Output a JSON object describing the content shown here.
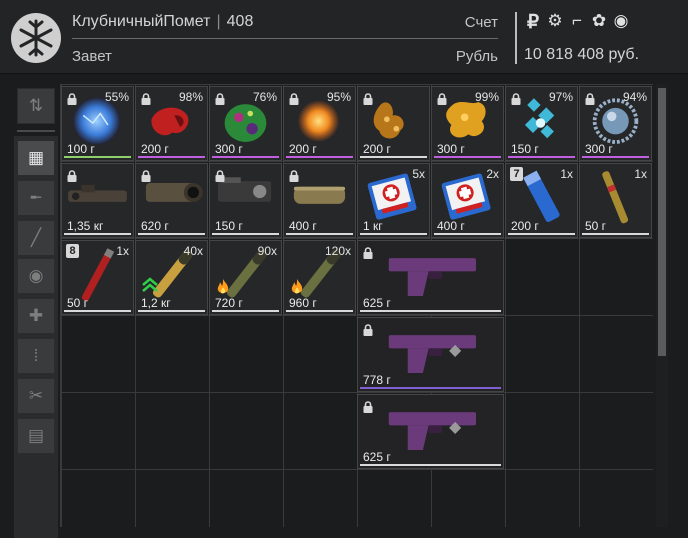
{
  "header": {
    "player_name": "КлубничныйПомет",
    "separator": "|",
    "player_level": "408",
    "faction": "Завет",
    "account_label": "Счет",
    "currency_label": "Рубль",
    "balance": "10 818 408 руб.",
    "currency_icons": [
      "ruble-icon",
      "gear-icon",
      "boot-icon",
      "flower-icon",
      "coin-icon"
    ]
  },
  "sidebar": {
    "items": [
      {
        "name": "sort-icon",
        "symbol": "⇅",
        "active": false
      },
      {
        "name": "grid-icon",
        "symbol": "▦",
        "active": true
      },
      {
        "name": "rifle-icon",
        "symbol": "╾",
        "active": false
      },
      {
        "name": "knife-icon",
        "symbol": "╱",
        "active": false
      },
      {
        "name": "artifact-icon",
        "symbol": "◉",
        "active": false
      },
      {
        "name": "medkit-icon",
        "symbol": "✚",
        "active": false
      },
      {
        "name": "ammo-icon",
        "symbol": "⁞",
        "active": false
      },
      {
        "name": "tools-icon",
        "symbol": "✂",
        "active": false
      },
      {
        "name": "archive-icon",
        "symbol": "▤",
        "active": false
      }
    ]
  },
  "items": [
    {
      "id": "art1",
      "weight": "100 г",
      "badge_tr": "55%",
      "lock": true,
      "underline": "#8fd06a",
      "color": "#3a7ad8"
    },
    {
      "id": "art2",
      "weight": "200 г",
      "badge_tr": "98%",
      "lock": true,
      "underline": "#c060e0",
      "color": "#c02020"
    },
    {
      "id": "art3",
      "weight": "300 г",
      "badge_tr": "76%",
      "lock": true,
      "underline": "#c060e0",
      "color": "#2a8a3a"
    },
    {
      "id": "art4",
      "weight": "200 г",
      "badge_tr": "95%",
      "lock": true,
      "underline": "#c060e0",
      "color": "#f08a20"
    },
    {
      "id": "art5",
      "weight": "200 г",
      "badge_tr": "",
      "lock": true,
      "underline": "#d9d9d9",
      "color": "#b8761a"
    },
    {
      "id": "art6",
      "weight": "300 г",
      "badge_tr": "99%",
      "lock": true,
      "underline": "#c060e0",
      "color": "#e0a020"
    },
    {
      "id": "art7",
      "weight": "150 г",
      "badge_tr": "97%",
      "lock": true,
      "underline": "#c060e0",
      "color": "#40b8d8"
    },
    {
      "id": "art8",
      "weight": "300 г",
      "badge_tr": "94%",
      "lock": true,
      "underline": "#c060e0",
      "color": "#7898b8"
    },
    {
      "id": "scope1",
      "weight": "1,35 кг",
      "badge_tr": "",
      "lock": true,
      "underline": "#d9d9d9",
      "color": "#4a4238"
    },
    {
      "id": "scope2",
      "weight": "620 г",
      "badge_tr": "",
      "lock": true,
      "underline": "#d9d9d9",
      "color": "#5a5040"
    },
    {
      "id": "scope3",
      "weight": "150 г",
      "badge_tr": "",
      "lock": true,
      "underline": "#d9d9d9",
      "color": "#3a3a3a"
    },
    {
      "id": "silencer",
      "weight": "400 г",
      "badge_tr": "",
      "lock": true,
      "underline": "#d9d9d9",
      "color": "#8a7a50"
    },
    {
      "id": "medkit1",
      "weight": "1 кг",
      "badge_tr": "5x",
      "lock": false,
      "underline": "#d9d9d9",
      "color": "#2a6ad0"
    },
    {
      "id": "medkit2",
      "weight": "400 г",
      "badge_tr": "2x",
      "lock": false,
      "underline": "#d9d9d9",
      "color": "#2a6ad0"
    },
    {
      "id": "inhaler",
      "weight": "200 г",
      "badge_tr": "1x",
      "lock": false,
      "num_badge": "7",
      "underline": "#d9d9d9",
      "color": "#2a6ad0"
    },
    {
      "id": "grenade",
      "weight": "50 г",
      "badge_tr": "1x",
      "lock": false,
      "underline": "#d9d9d9",
      "color": "#a88a30"
    },
    {
      "id": "flare",
      "weight": "50 г",
      "badge_tr": "1x",
      "lock": false,
      "num_badge": "8",
      "underline": "#d9d9d9",
      "color": "#b02020"
    },
    {
      "id": "ammo1",
      "weight": "1,2 кг",
      "badge_tr": "40x",
      "lock": false,
      "underline": "#d9d9d9",
      "color": "#c8a040",
      "rank": true
    },
    {
      "id": "ammo2",
      "weight": "720 г",
      "badge_tr": "90x",
      "lock": false,
      "underline": "#d9d9d9",
      "color": "#6a7040",
      "fire": true
    },
    {
      "id": "ammo3",
      "weight": "960 г",
      "badge_tr": "120x",
      "lock": false,
      "underline": "#d9d9d9",
      "color": "#6a7040",
      "fire": true
    },
    {
      "id": "pistol1",
      "weight": "625 г",
      "badge_tr": "",
      "lock": true,
      "underline": "#d9d9d9",
      "color": "#6a3a7a"
    },
    {
      "id": "pistol2",
      "weight": "778 г",
      "badge_tr": "",
      "lock": true,
      "underline": "#8060d0",
      "color": "#6a3a7a",
      "charm": true
    },
    {
      "id": "pistol3",
      "weight": "625 г",
      "badge_tr": "",
      "lock": true,
      "underline": "#d9d9d9",
      "color": "#6a3a7a",
      "charm": true
    }
  ]
}
